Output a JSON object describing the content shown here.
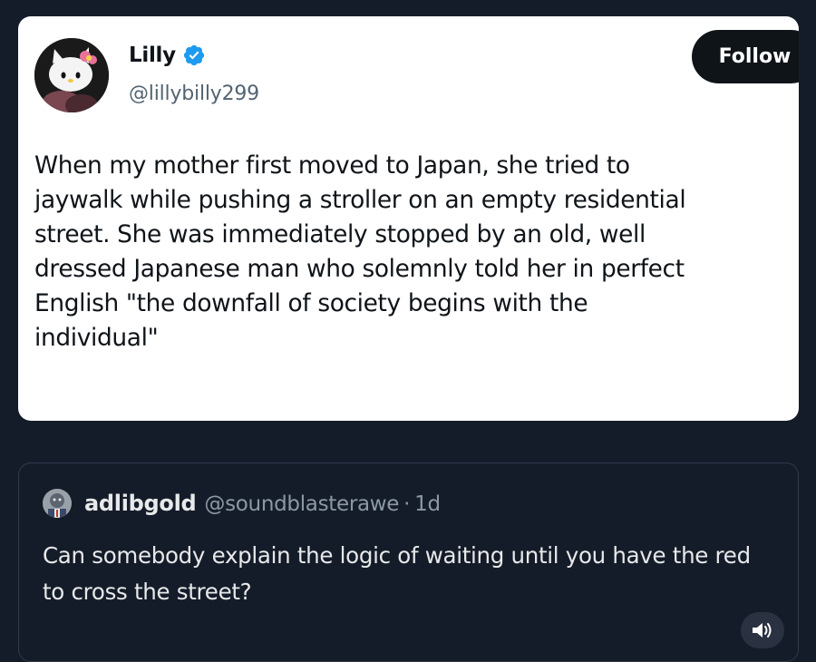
{
  "tweet": {
    "author": {
      "display_name": "Lilly",
      "handle": "@lillybilly299",
      "verified_icon": "verified-badge-icon",
      "avatar_icon": "hello-kitty-avatar"
    },
    "follow_label": "Follow",
    "text": "When my mother first moved to Japan, she tried to\njaywalk while pushing a stroller on an empty residential\nstreet. She was immediately stopped by an old, well\ndressed Japanese man who solemnly told her in perfect\nEnglish \"the downfall of society begins with the\nindividual\""
  },
  "reply": {
    "author": {
      "display_name": "adlibgold",
      "handle": "@soundblasterawe",
      "avatar_icon": "user-avatar"
    },
    "separator": "·",
    "time": "1d",
    "text": "Can somebody explain the logic of waiting until you have the red to cross the street?"
  },
  "controls": {
    "sound_icon": "speaker-icon"
  },
  "colors": {
    "background": "#151c29",
    "card": "#ffffff",
    "verified": "#1d9bf0",
    "follow_button": "#0f1419",
    "muted_text": "#8b98a5"
  }
}
